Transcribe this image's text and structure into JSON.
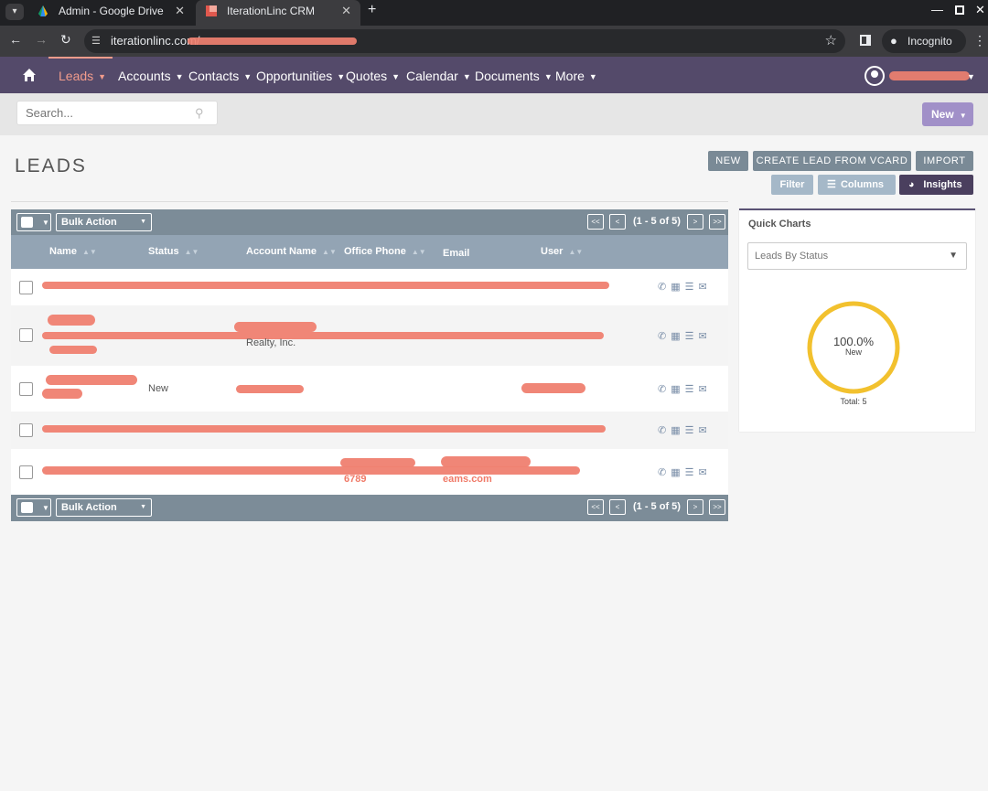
{
  "browser": {
    "tabs": [
      {
        "title": "Admin - Google Drive",
        "active": false
      },
      {
        "title": "IterationLinc CRM",
        "active": true
      }
    ],
    "url_prefix": "iterationlinc.com/",
    "incognito_label": "Incognito"
  },
  "nav": {
    "items": [
      {
        "label": "Leads",
        "active": true
      },
      {
        "label": "Accounts"
      },
      {
        "label": "Contacts"
      },
      {
        "label": "Opportunities"
      },
      {
        "label": "Quotes"
      },
      {
        "label": "Calendar"
      },
      {
        "label": "Documents"
      },
      {
        "label": "More"
      }
    ]
  },
  "search": {
    "placeholder": "Search..."
  },
  "new_button": "New",
  "page_title": "LEADS",
  "actions": {
    "new": "NEW",
    "vcard": "CREATE LEAD FROM VCARD",
    "import": "IMPORT",
    "filter": "Filter",
    "columns": "Columns",
    "insights": "Insights"
  },
  "table": {
    "bulk_action": "Bulk Action",
    "pagination": "(1 - 5 of 5)",
    "pager": {
      "first": "<<",
      "prev": "<",
      "next": ">",
      "last": ">>"
    },
    "columns": [
      "Name",
      "Status",
      "Account Name",
      "Office Phone",
      "Email",
      "User"
    ],
    "rows": [
      {
        "status": "",
        "account": "",
        "phone": "",
        "email": ""
      },
      {
        "status": "",
        "account": "Realty, Inc.",
        "phone": "",
        "email": ""
      },
      {
        "status": "New",
        "account": "",
        "phone": "",
        "email": ""
      },
      {
        "status": "",
        "account": "",
        "phone": "",
        "email": ""
      },
      {
        "status": "",
        "account": "",
        "phone": "6789",
        "email": "eams.com"
      }
    ]
  },
  "quick_charts": {
    "title": "Quick Charts",
    "selected": "Leads By Status",
    "chart_data": {
      "type": "pie",
      "categories": [
        "New"
      ],
      "values": [
        100.0
      ],
      "percent_label": "100.0%",
      "total_label": "Total: 5"
    }
  },
  "colors": {
    "nav_bg": "#544a6a",
    "active": "#f29c8c",
    "donut": "#f2c12e"
  }
}
